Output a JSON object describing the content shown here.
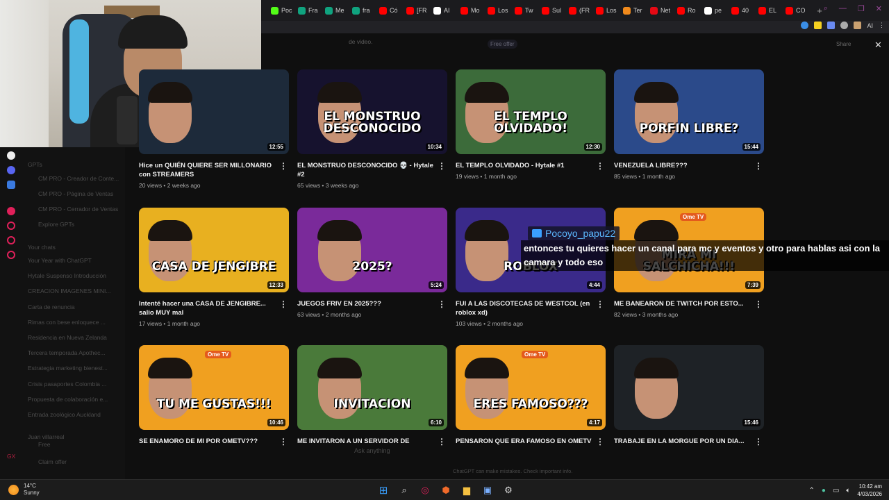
{
  "tabs": [
    {
      "label": "Poc",
      "icon": "kick-icon",
      "color": "#53fc18"
    },
    {
      "label": "Fra",
      "icon": "chatgpt-icon",
      "color": "#10a37f"
    },
    {
      "label": "Me",
      "icon": "chatgpt-icon",
      "color": "#10a37f"
    },
    {
      "label": "fra",
      "icon": "chatgpt-icon",
      "color": "#10a37f"
    },
    {
      "label": "Có",
      "icon": "youtube-icon",
      "color": "#ff0000"
    },
    {
      "label": "[FR",
      "icon": "youtube-icon",
      "color": "#ff0000"
    },
    {
      "label": "AI",
      "icon": "notion-icon",
      "color": "#ffffff"
    },
    {
      "label": "Mo",
      "icon": "youtube-icon",
      "color": "#ff0000"
    },
    {
      "label": "Los",
      "icon": "youtube-icon",
      "color": "#ff0000"
    },
    {
      "label": "Tw",
      "icon": "youtube-icon",
      "color": "#ff0000"
    },
    {
      "label": "Sul",
      "icon": "youtube-icon",
      "color": "#ff0000"
    },
    {
      "label": "(FR",
      "icon": "youtube-icon",
      "color": "#ff0000"
    },
    {
      "label": "Los",
      "icon": "youtube-icon",
      "color": "#ff0000"
    },
    {
      "label": "Ter",
      "icon": "orange-icon",
      "color": "#f08a1c"
    },
    {
      "label": "Net",
      "icon": "netflix-icon",
      "color": "#e50914"
    },
    {
      "label": "Ro",
      "icon": "youtube-icon",
      "color": "#ff0000"
    },
    {
      "label": "pe",
      "icon": "google-icon",
      "color": "#ffffff"
    },
    {
      "label": "40",
      "icon": "youtube-icon",
      "color": "#ff0000"
    },
    {
      "label": "EL",
      "icon": "youtube-icon",
      "color": "#ff0000"
    },
    {
      "label": "CO",
      "icon": "youtube-icon",
      "color": "#ff0000"
    }
  ],
  "toolbar": {
    "ai_label": "AI"
  },
  "ghost_sidebar": {
    "gpts_heading": "GPTs",
    "gpts": [
      "CM PRO - Creador de Conte...",
      "CM PRO - Página de Ventas",
      "CM PRO - Cerrador de Ventas"
    ],
    "explore": "Explore GPTs",
    "chats_heading": "Your chats",
    "chats": [
      "Your Year with ChatGPT",
      "Hytale Suspenso Introducción",
      "CREACION IMAGENES MINI...",
      "Carta de renuncia",
      "Rimas con bese enloquece ...",
      "Residencia en Nueva Zelanda",
      "Tercera temporada Apothec...",
      "Estrategia marketing bienest...",
      "Crisis pasaportes Colombia ...",
      "Propuesta de colaboración e...",
      "Entrada zoológico Auckland"
    ],
    "user_name": "Juan villarreal",
    "user_plan": "Free",
    "claim": "Claim offer",
    "gx": "GX"
  },
  "ghost_top": {
    "desc": "de video.",
    "offer": "Free offer",
    "share": "Share"
  },
  "videos": [
    {
      "title": "Hice un QUIÉN QUIERE SER MILLONARIO con STREAMERS",
      "stats": "20 views • 2 weeks ago",
      "duration": "12:55",
      "overlay": "",
      "bg": "#1d2a3a"
    },
    {
      "title": "EL MONSTRUO DESCONOCIDO 💀 - Hytale #2",
      "stats": "65 views • 3 weeks ago",
      "duration": "10:34",
      "overlay": "EL MONSTRUO DESCONOCIDO",
      "bg": "#16122e"
    },
    {
      "title": "EL TEMPLO OLVIDADO - Hytale #1",
      "stats": "19 views • 1 month ago",
      "duration": "12:30",
      "overlay": "EL TEMPLO OLVIDADO!",
      "bg": "#3c6b3a"
    },
    {
      "title": "VENEZUELA LIBRE???",
      "stats": "85 views • 1 month ago",
      "duration": "15:44",
      "overlay": "PORFIN LIBRE?",
      "bg": "#2b4a8a"
    },
    {
      "title": "Intenté hacer una CASA DE JENGIBRE... salio MUY mal",
      "stats": "17 views • 1 month ago",
      "duration": "12:33",
      "overlay": "CASA DE JENGIBRE",
      "bg": "#e8b020"
    },
    {
      "title": "JUEGOS FRIV EN 2025???",
      "stats": "63 views • 2 months ago",
      "duration": "5:24",
      "overlay": "2025?",
      "bg": "#7a2a9a"
    },
    {
      "title": "FUI A LAS DISCOTECAS DE WESTCOL (en roblox xd)",
      "stats": "103 views • 2 months ago",
      "duration": "4:44",
      "overlay": "ROBLOX",
      "bg": "#3a2a8a"
    },
    {
      "title": "ME BANEARON DE TWITCH POR ESTO...",
      "stats": "82 views • 3 months ago",
      "duration": "7:39",
      "overlay": "MIRA MI SALCHICHA!!!",
      "bg": "#f0a020"
    },
    {
      "title": "SE ENAMORO DE MI POR OMETV???",
      "stats": "",
      "duration": "10:46",
      "overlay": "TU ME GUSTAS!!!",
      "bg": "#f0a020"
    },
    {
      "title": "ME INVITARON A UN SERVIDOR DE",
      "stats": "",
      "duration": "6:10",
      "overlay": "INVITACION",
      "bg": "#4a7a3a"
    },
    {
      "title": "PENSARON QUE ERA FAMOSO EN OMETV",
      "stats": "",
      "duration": "4:17",
      "overlay": "ERES FAMOSO???",
      "bg": "#f0a020"
    },
    {
      "title": "TRABAJE EN LA MORGUE POR UN DIA...",
      "stats": "",
      "duration": "15:46",
      "overlay": "",
      "bg": "#1e2226"
    }
  ],
  "ometv_badge": "Ome TV",
  "roblox_text": "RUBLOX",
  "chat": {
    "username": "Pocoyo_papu22",
    "message": "entonces tu quieres hacer un canal para mc y eventos y otro para hablas asi con la camara y todo eso"
  },
  "ghost_bottom": {
    "input": "Ask anything",
    "footer": "ChatGPT can make mistakes. Check important info."
  },
  "taskbar": {
    "temp": "14°C",
    "condition": "Sunny",
    "time": "10:42 am",
    "date": "4/03/2026"
  }
}
